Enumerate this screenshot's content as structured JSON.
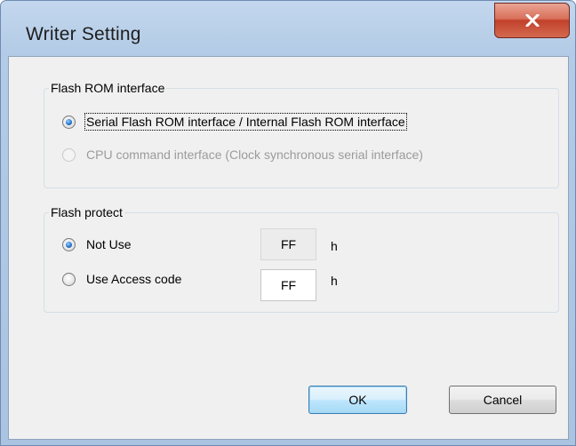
{
  "window": {
    "title": "Writer Setting"
  },
  "flash_rom_interface": {
    "label": "Flash ROM interface",
    "options": [
      {
        "label": "Serial Flash ROM interface / Internal Flash ROM interface",
        "selected": true,
        "enabled": true
      },
      {
        "label": "CPU command interface (Clock synchronous serial interface)",
        "selected": false,
        "enabled": false
      }
    ]
  },
  "flash_protect": {
    "label": "Flash protect",
    "options": [
      {
        "label": "Not Use",
        "selected": true,
        "value": "FF",
        "unit": "h"
      },
      {
        "label": "Use Access code",
        "selected": false,
        "value": "FF",
        "unit": "h"
      }
    ]
  },
  "buttons": {
    "ok": "OK",
    "cancel": "Cancel"
  },
  "colors": {
    "accent": "#3c7fb1",
    "close": "#c2412b"
  },
  "icons": {
    "close": "close-icon"
  }
}
